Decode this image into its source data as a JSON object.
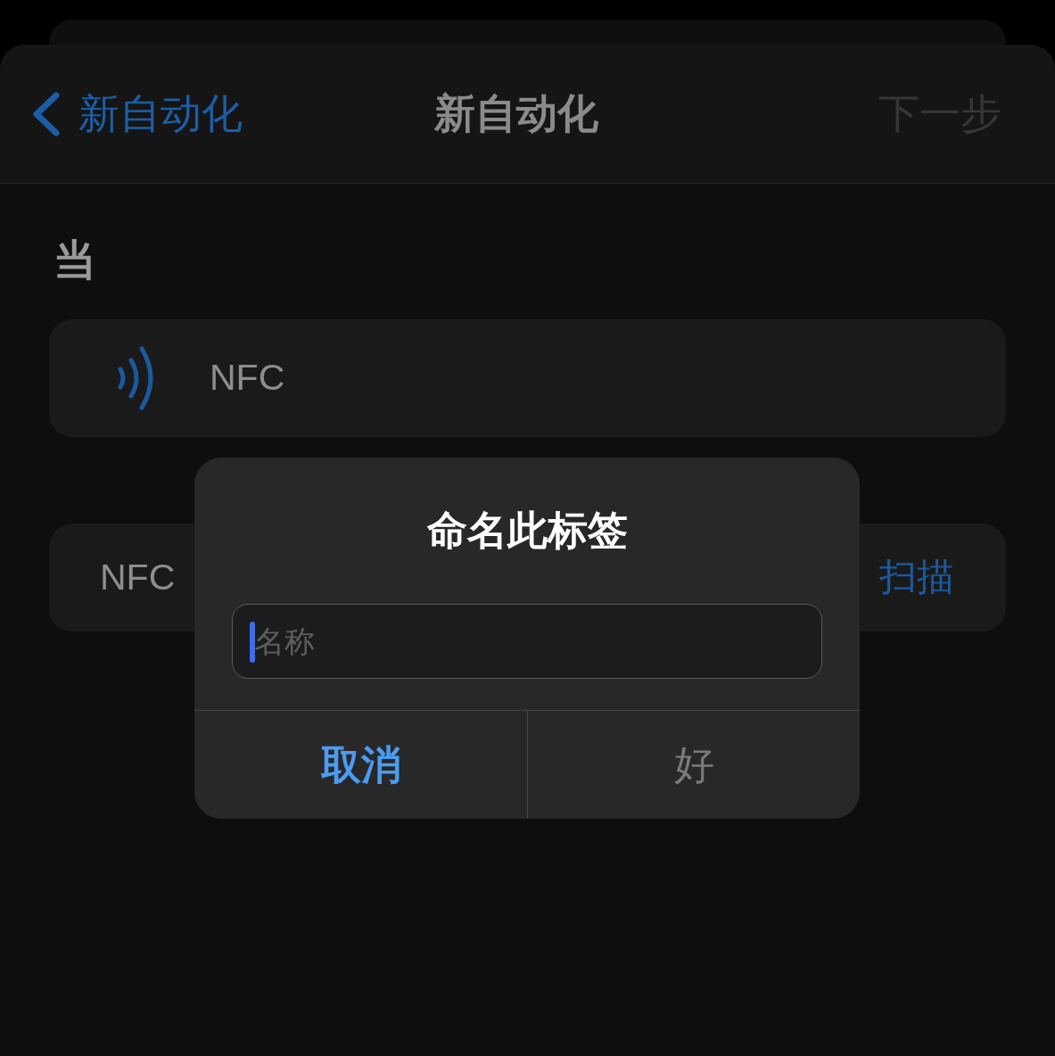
{
  "navigation": {
    "back": {
      "label": "新自动化"
    },
    "title": "新自动化",
    "next": {
      "label": "下一步",
      "disabled": true
    }
  },
  "section": {
    "header": "当"
  },
  "trigger": {
    "label": "NFC"
  },
  "tag_row": {
    "label": "NFC",
    "action": "扫描"
  },
  "dialog": {
    "title": "命名此标签",
    "field": {
      "placeholder": "名称",
      "focused": true
    },
    "buttons": [
      {
        "label": "取消",
        "kind": "cancel",
        "disabled": false
      },
      {
        "label": "好",
        "kind": "confirm",
        "disabled": true
      }
    ]
  }
}
